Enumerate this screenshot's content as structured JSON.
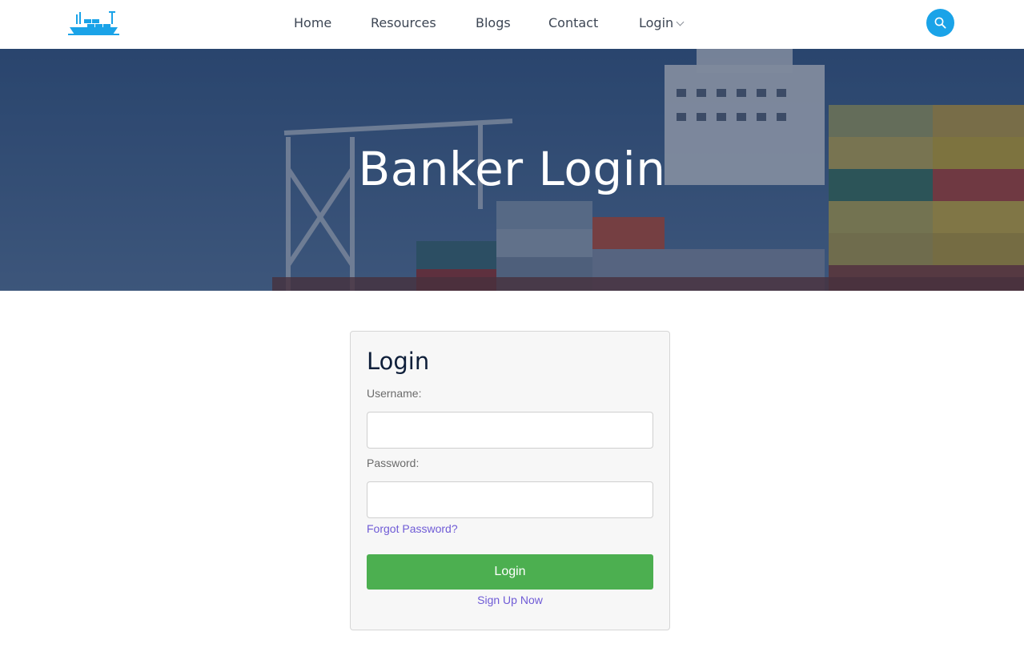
{
  "header": {
    "logo_icon": "cargo-ship-icon",
    "nav": [
      {
        "label": "Home"
      },
      {
        "label": "Resources"
      },
      {
        "label": "Blogs"
      },
      {
        "label": "Contact"
      },
      {
        "label": "Login"
      }
    ],
    "search_icon": "search-icon",
    "accent_color": "#1aa3e8"
  },
  "hero": {
    "title": "Banker Login",
    "background": "cargo ship with containers at port"
  },
  "login_card": {
    "title": "Login",
    "username_label": "Username:",
    "username_value": "",
    "password_label": "Password:",
    "password_value": "",
    "forgot_link": "Forgot Password?",
    "submit_label": "Login",
    "submit_color": "#4caf50",
    "signup_link": "Sign Up Now",
    "link_color": "#6f5bd6"
  }
}
